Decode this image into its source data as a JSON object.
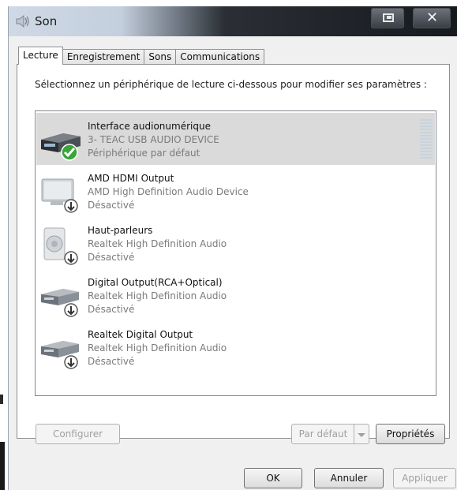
{
  "window": {
    "title": "Son"
  },
  "tabs": [
    {
      "label": "Lecture",
      "active": true
    },
    {
      "label": "Enregistrement",
      "active": false
    },
    {
      "label": "Sons",
      "active": false
    },
    {
      "label": "Communications",
      "active": false
    }
  ],
  "instruction": "Sélectionnez un périphérique de lecture ci-dessous pour modifier ses paramètres :",
  "devices": [
    {
      "name": "Interface audionumérique",
      "description": "3- TEAC USB AUDIO DEVICE",
      "status": "Périphérique par défaut",
      "icon": "audio-interface-default-icon",
      "selected": true
    },
    {
      "name": "AMD HDMI Output",
      "description": "AMD High Definition Audio Device",
      "status": "Désactivé",
      "icon": "monitor-disabled-icon",
      "selected": false
    },
    {
      "name": "Haut-parleurs",
      "description": "Realtek High Definition Audio",
      "status": "Désactivé",
      "icon": "speaker-disabled-icon",
      "selected": false
    },
    {
      "name": "Digital Output(RCA+Optical)",
      "description": "Realtek High Definition Audio",
      "status": "Désactivé",
      "icon": "digital-output-disabled-icon",
      "selected": false
    },
    {
      "name": "Realtek Digital Output",
      "description": "Realtek High Definition Audio",
      "status": "Désactivé",
      "icon": "digital-output-disabled-icon",
      "selected": false
    }
  ],
  "buttons": {
    "configure": "Configurer",
    "set_default": "Par défaut",
    "properties": "Propriétés",
    "ok": "OK",
    "cancel": "Annuler",
    "apply": "Appliquer"
  },
  "colors": {
    "selection": "#dadada",
    "check_green": "#3aa33a",
    "disabled_text": "#a0a0a0"
  }
}
